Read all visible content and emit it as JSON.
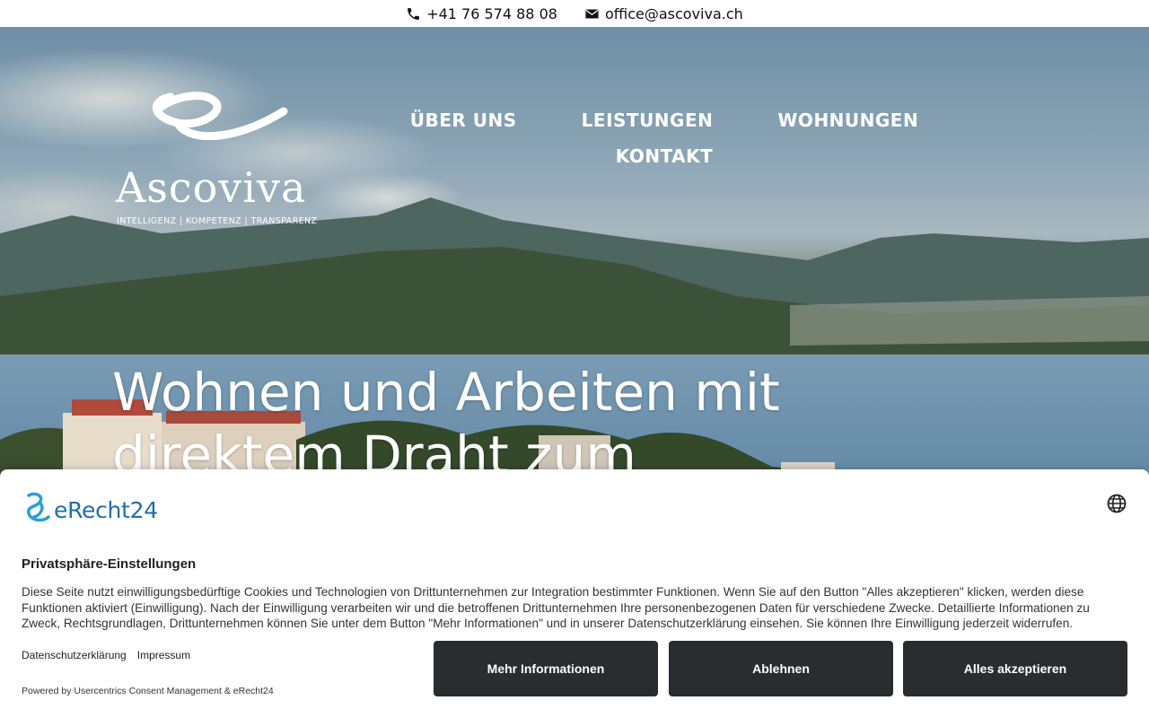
{
  "topbar": {
    "phone": "+41 76 574 88 08",
    "email": "office@ascoviva.ch",
    "phone_icon": "phone-icon",
    "email_icon": "envelope-icon"
  },
  "logo": {
    "name": "Ascoviva",
    "tagline": "INTELLIGENZ | KOMPETENZ | TRANSPARENZ"
  },
  "nav": {
    "items": [
      {
        "label": "ÜBER UNS"
      },
      {
        "label": "LEISTUNGEN"
      },
      {
        "label": "WOHNUNGEN"
      },
      {
        "label": "KONTAKT"
      }
    ]
  },
  "hero": {
    "headline": "Wohnen und Arbeiten mit direktem Draht zum"
  },
  "consent": {
    "brand": "eRecht24",
    "title": "Privatsphäre-Einstellungen",
    "text": "Diese Seite nutzt einwilligungsbedürftige Cookies und Technologien von Drittunternehmen zur Integration bestimmter Funktionen. Wenn Sie auf den Button \"Alles akzeptieren\" klicken, werden diese Funktionen aktiviert (Einwilligung). Nach der Einwilligung verarbeiten wir und die betroffenen Drittunternehmen Ihre personenbezogenen Daten für verschiedene Zwecke. Detaillierte Informationen zu Zweck, Rechtsgrundlagen, Drittunternehmen können Sie unter dem Button \"Mehr Informationen\" und in unserer Datenschutzerklärung einsehen. Sie können Ihre Einwilligung jederzeit widerrufen.",
    "links": {
      "privacy": "Datenschutzerklärung",
      "imprint": "Impressum"
    },
    "powered_by": "Powered by Usercentrics Consent Management & eRecht24",
    "buttons": {
      "more": "Mehr Informationen",
      "deny": "Ablehnen",
      "accept": "Alles akzeptieren"
    },
    "language_icon": "globe-icon"
  },
  "colors": {
    "button_bg": "#2b2c30",
    "brand_blue": "#1f6fa8"
  }
}
